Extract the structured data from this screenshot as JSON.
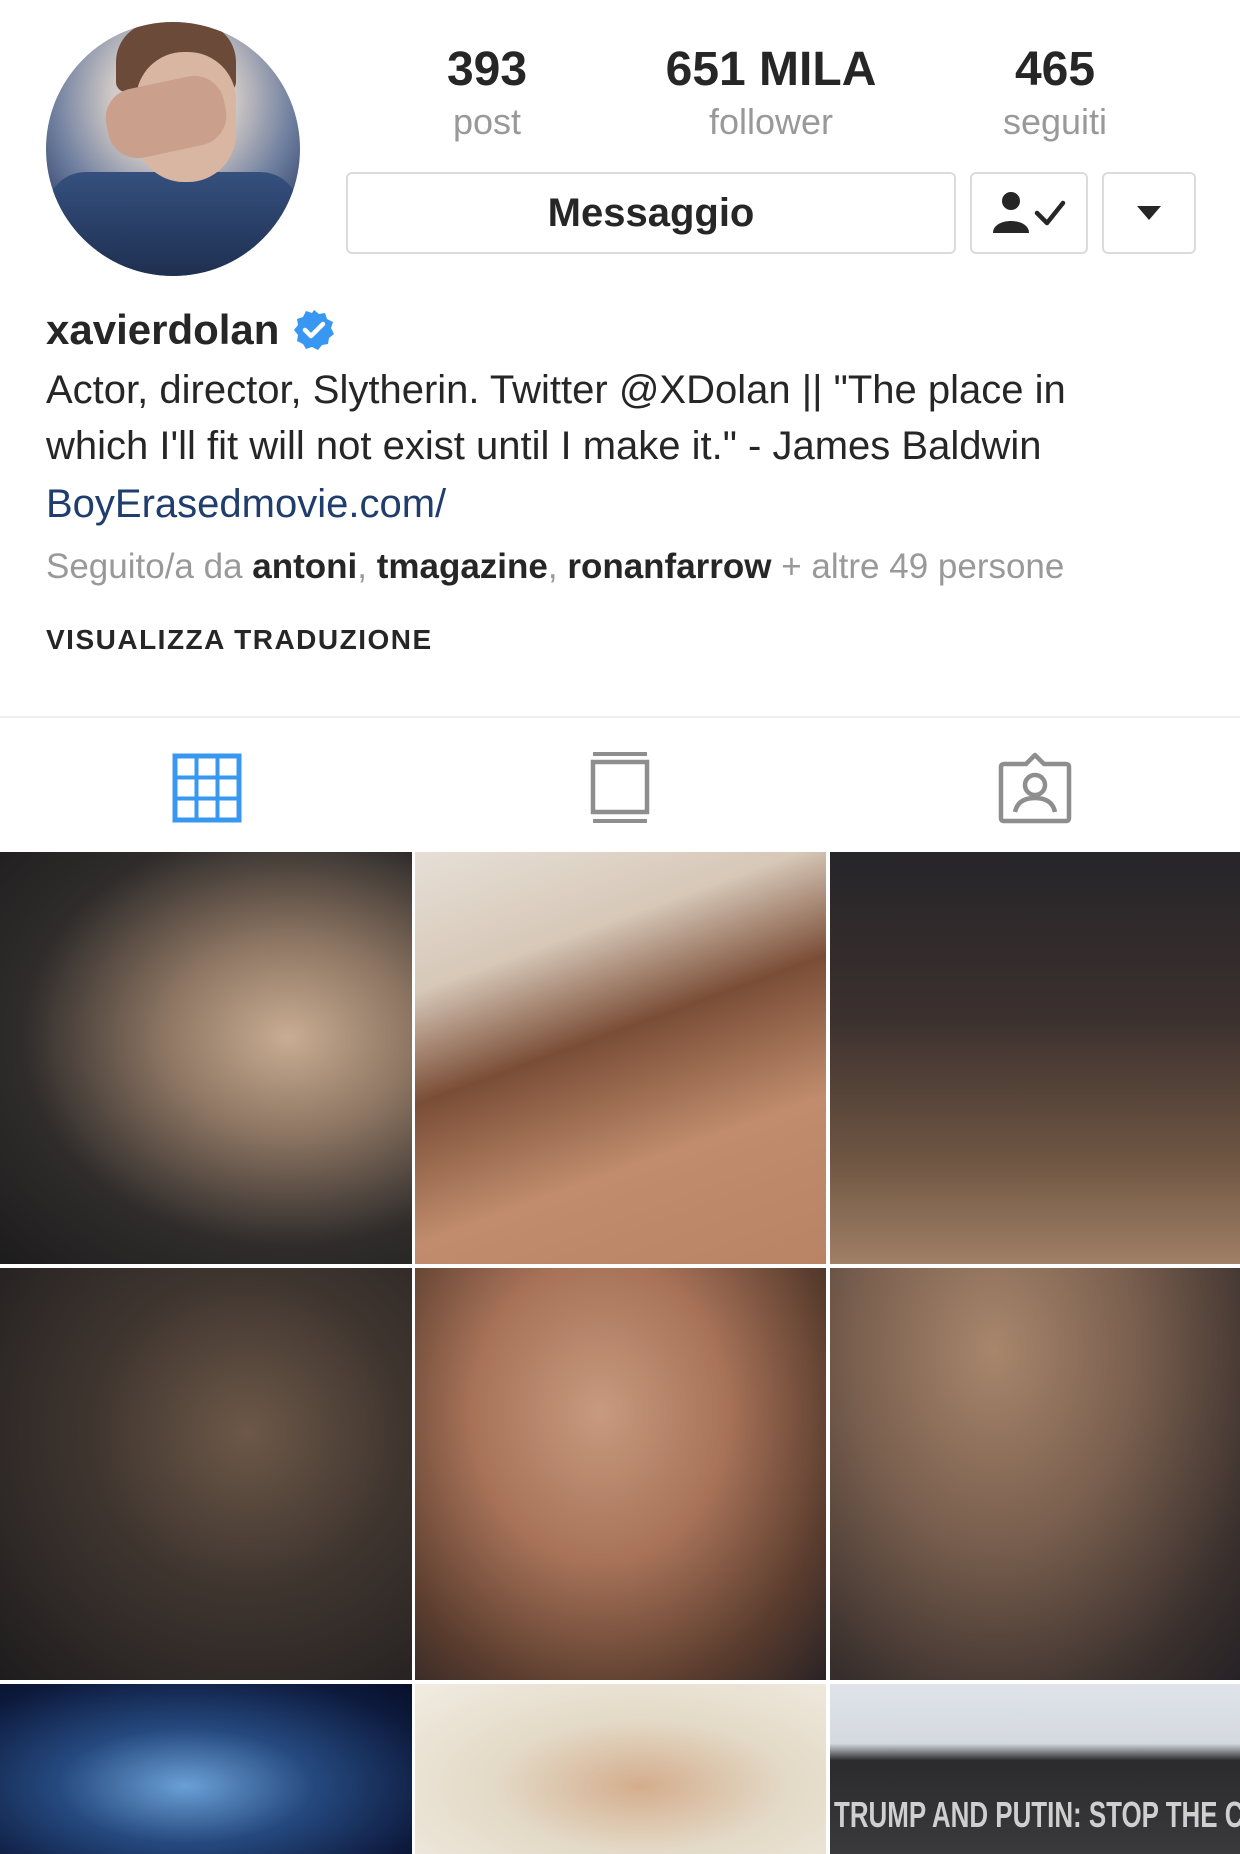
{
  "profile": {
    "username": "xavierdolan",
    "verified": true,
    "stats": [
      {
        "value": "393",
        "label": "post"
      },
      {
        "value": "651 MILA",
        "label": "follower"
      },
      {
        "value": "465",
        "label": "seguiti"
      }
    ],
    "bio_line1": "Actor, director, Slytherin. Twitter @XDolan || \"The place in",
    "bio_line2": "which I'll fit will not exist until I make it.\" - James Baldwin",
    "link": "BoyErasedmovie.com/",
    "followed_by": {
      "prefix": "Seguito/a da ",
      "users": [
        "antoni",
        "tmagazine",
        "ronanfarrow"
      ],
      "suffix": " + altre 49 persone"
    },
    "translate_label": "VISUALIZZA TRADUZIONE"
  },
  "buttons": {
    "message_label": "Messaggio",
    "follow_icon": "person-check-icon",
    "dropdown_icon": "caret-down-icon"
  },
  "tabs": [
    {
      "icon": "grid-icon",
      "active": true
    },
    {
      "icon": "feed-icon",
      "active": false
    },
    {
      "icon": "tagged-icon",
      "active": false
    }
  ],
  "colors": {
    "active_tab": "#3897f0",
    "verified_badge": "#3897f0",
    "link": "#1f3d6d",
    "secondary_text": "#999999"
  },
  "posts": {
    "banner_text": "TRUMP AND PUTIN: STOP THE CRIM"
  }
}
